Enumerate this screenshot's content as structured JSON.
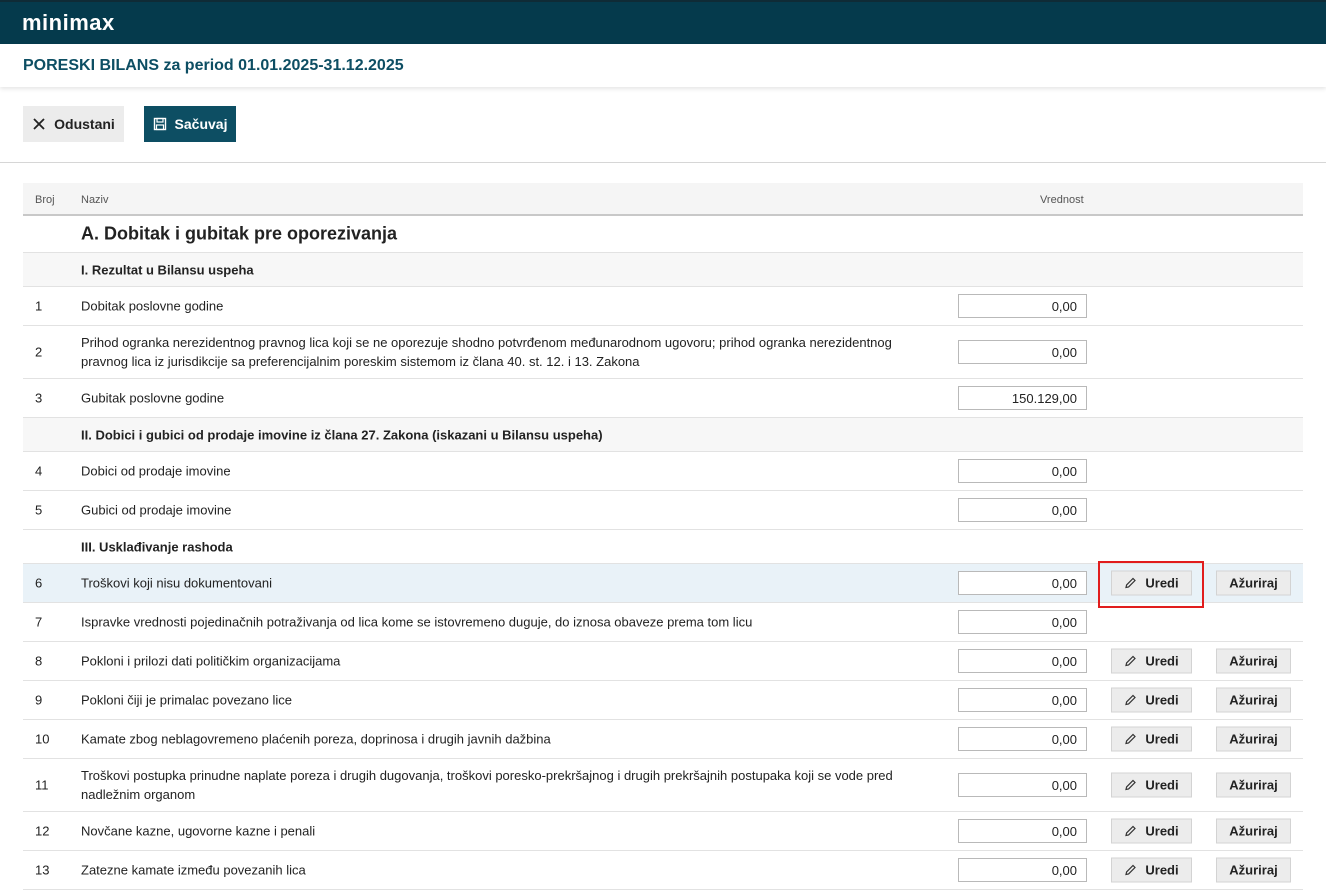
{
  "app": {
    "logo_text": "minimax"
  },
  "page": {
    "title": "PORESKI BILANS za period 01.01.2025-31.12.2025"
  },
  "toolbar": {
    "cancel_label": "Odustani",
    "save_label": "Sačuvaj"
  },
  "table": {
    "headers": {
      "num": "Broj",
      "name": "Naziv",
      "value": "Vrednost"
    },
    "section_a": "A. Dobitak i gubitak pre oporezivanja",
    "section_1": "I. Rezultat u Bilansu uspeha",
    "section_2": "II. Dobici i gubici od prodaje imovine iz člana 27. Zakona (iskazani u Bilansu uspeha)",
    "section_3": "III. Usklađivanje rashoda",
    "rows": [
      {
        "num": "1",
        "name": "Dobitak poslovne godine",
        "value": "0,00"
      },
      {
        "num": "2",
        "name": "Prihod ogranka nerezidentnog pravnog lica koji se ne oporezuje shodno potvrđenom međunarodnom ugovoru; prihod ogranka nerezidentnog pravnog lica iz jurisdikcije sa preferencijalnim poreskim sistemom iz člana 40. st. 12. i 13. Zakona",
        "value": "0,00"
      },
      {
        "num": "3",
        "name": "Gubitak poslovne godine",
        "value": "150.129,00"
      },
      {
        "num": "4",
        "name": "Dobici od prodaje imovine",
        "value": "0,00"
      },
      {
        "num": "5",
        "name": "Gubici od prodaje imovine",
        "value": "0,00"
      },
      {
        "num": "6",
        "name": "Troškovi koji nisu dokumentovani",
        "value": "0,00"
      },
      {
        "num": "7",
        "name": "Ispravke vrednosti pojedinačnih potraživanja od lica kome se istovremeno duguje, do iznosa obaveze prema tom licu",
        "value": "0,00"
      },
      {
        "num": "8",
        "name": "Pokloni i prilozi dati političkim organizacijama",
        "value": "0,00"
      },
      {
        "num": "9",
        "name": "Pokloni čiji je primalac povezano lice",
        "value": "0,00"
      },
      {
        "num": "10",
        "name": "Kamate zbog neblagovremeno plaćenih poreza, doprinosa i drugih javnih dažbina",
        "value": "0,00"
      },
      {
        "num": "11",
        "name": "Troškovi postupka prinudne naplate poreza i drugih dugovanja, troškovi poresko-prekršajnog i drugih prekršajnih postupaka koji se vode pred nadležnim organom",
        "value": "0,00"
      },
      {
        "num": "12",
        "name": "Novčane kazne, ugovorne kazne i penali",
        "value": "0,00"
      },
      {
        "num": "13",
        "name": "Zatezne kamate između povezanih lica",
        "value": "0,00"
      }
    ],
    "edit_label": "Uredi",
    "update_label": "Ažuriraj"
  },
  "colors": {
    "header_bg": "#053a4c",
    "accent": "#0d4e63",
    "highlight_frame": "#e11d1d",
    "highlight_row": "#e9f2f8"
  }
}
